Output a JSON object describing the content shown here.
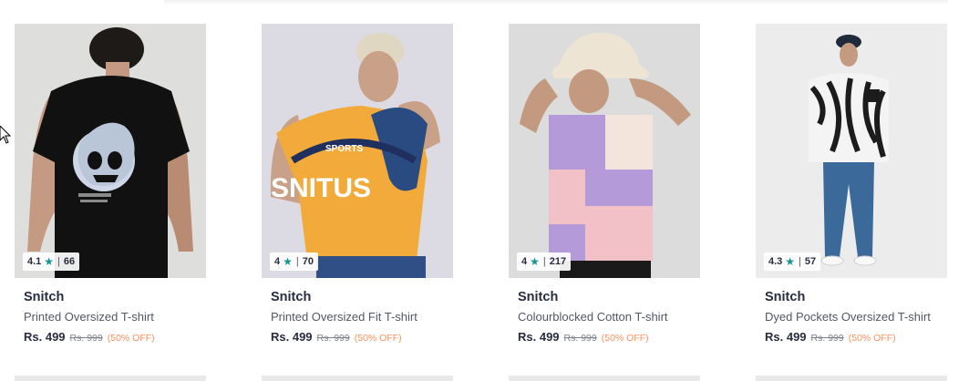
{
  "products": [
    {
      "rating": "4.1",
      "count": "66",
      "brand": "Snitch",
      "name": "Printed Oversized T-shirt",
      "price": "Rs. 499",
      "mrp": "Rs. 999",
      "discount": "(50% OFF)"
    },
    {
      "rating": "4",
      "count": "70",
      "brand": "Snitch",
      "name": "Printed Oversized Fit T-shirt",
      "price": "Rs. 499",
      "mrp": "Rs. 999",
      "discount": "(50% OFF)"
    },
    {
      "rating": "4",
      "count": "217",
      "brand": "Snitch",
      "name": "Colourblocked Cotton T-shirt",
      "price": "Rs. 499",
      "mrp": "Rs. 999",
      "discount": "(50% OFF)"
    },
    {
      "rating": "4.3",
      "count": "57",
      "brand": "Snitch",
      "name": "Dyed Pockets Oversized T-shirt",
      "price": "Rs. 499",
      "mrp": "Rs. 999",
      "discount": "(50% OFF)"
    }
  ],
  "colors": {
    "rating_star": "#14958f",
    "discount": "#ff905a",
    "brand_text": "#282c3f"
  },
  "icons": {
    "rating": "star-icon",
    "cursor": "mouse-pointer-icon"
  }
}
